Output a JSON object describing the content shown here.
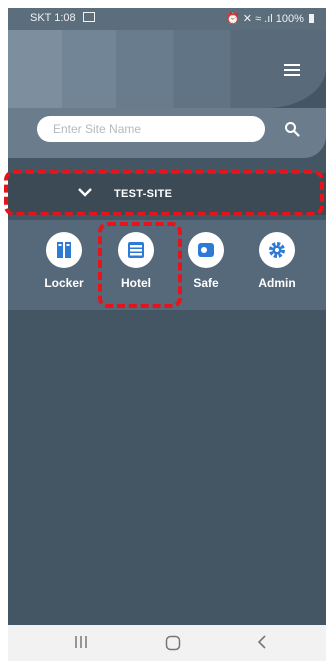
{
  "status_bar": {
    "carrier_time": "SKT 1:08",
    "battery": "100%"
  },
  "search": {
    "placeholder": "Enter Site Name",
    "value": ""
  },
  "site": {
    "name": "TEST-SITE"
  },
  "apps": [
    {
      "label": "Locker",
      "icon": "locker-icon"
    },
    {
      "label": "Hotel",
      "icon": "hotel-icon"
    },
    {
      "label": "Safe",
      "icon": "safe-icon"
    },
    {
      "label": "Admin",
      "icon": "gear-icon"
    }
  ],
  "nav": {
    "icons": [
      "recent-apps-icon",
      "home-icon",
      "back-icon"
    ]
  },
  "colors": {
    "highlight": "#e8131a",
    "accent": "#2e7bd6"
  }
}
